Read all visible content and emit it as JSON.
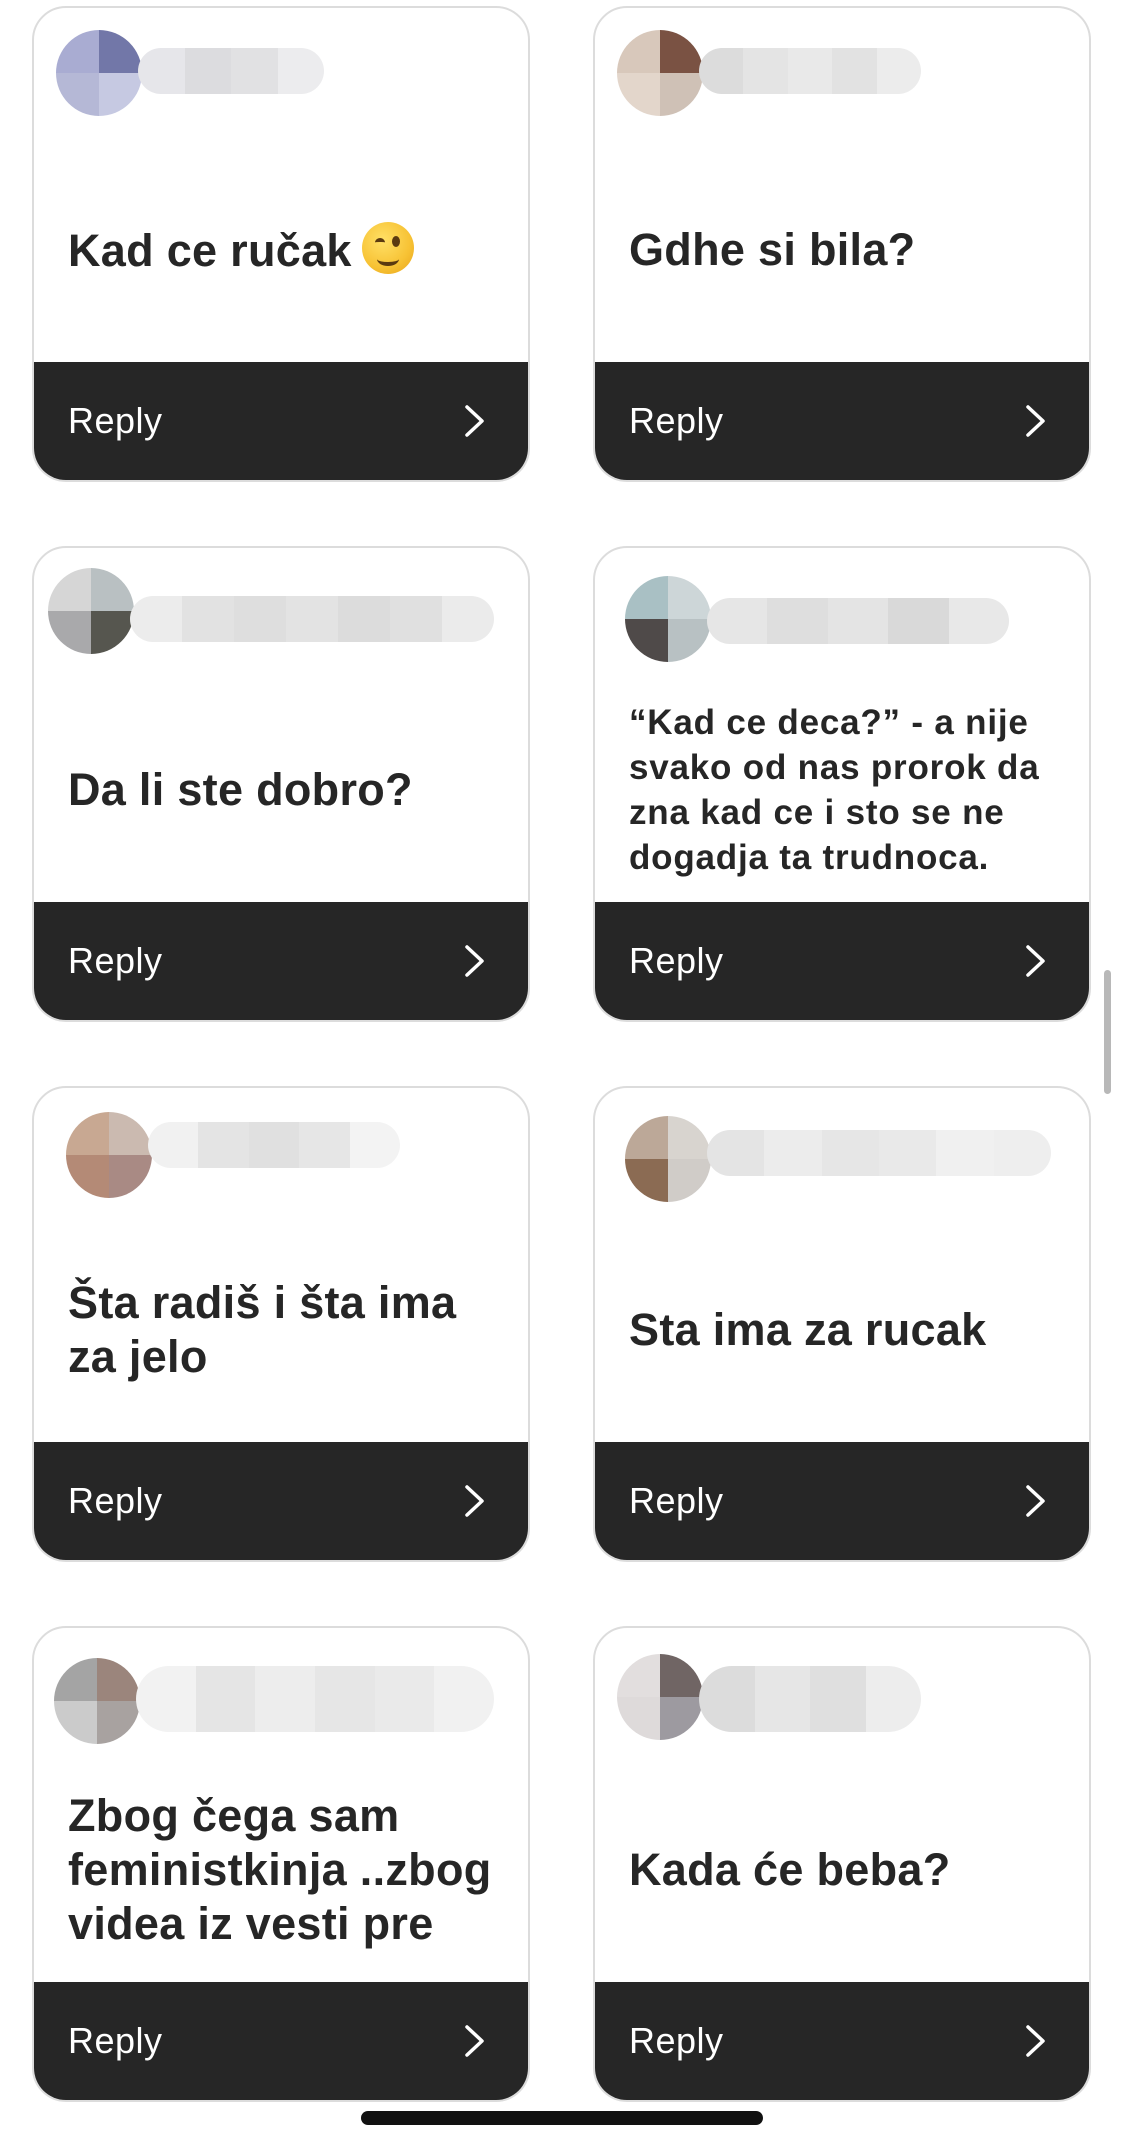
{
  "reply_label": "Reply",
  "accent": {
    "bar": "#262626",
    "text": "#262626",
    "border": "#dcdcdc"
  },
  "cards": [
    {
      "question": "Kad ce ručak",
      "emoji": "winking-face"
    },
    {
      "question": "Gdhe si bila?"
    },
    {
      "question": "Da li ste dobro?"
    },
    {
      "question": "“Kad ce deca?” - a nije svako od nas prorok da zna kad ce i sto se ne dogadja ta trudnoca."
    },
    {
      "question": "Šta radiš i šta ima za jelo"
    },
    {
      "question": "Sta ima za rucak"
    },
    {
      "question": "Zbog čega sam feministkinja ..zbog videa iz vesti pre"
    },
    {
      "question": "Kada će beba?"
    }
  ]
}
